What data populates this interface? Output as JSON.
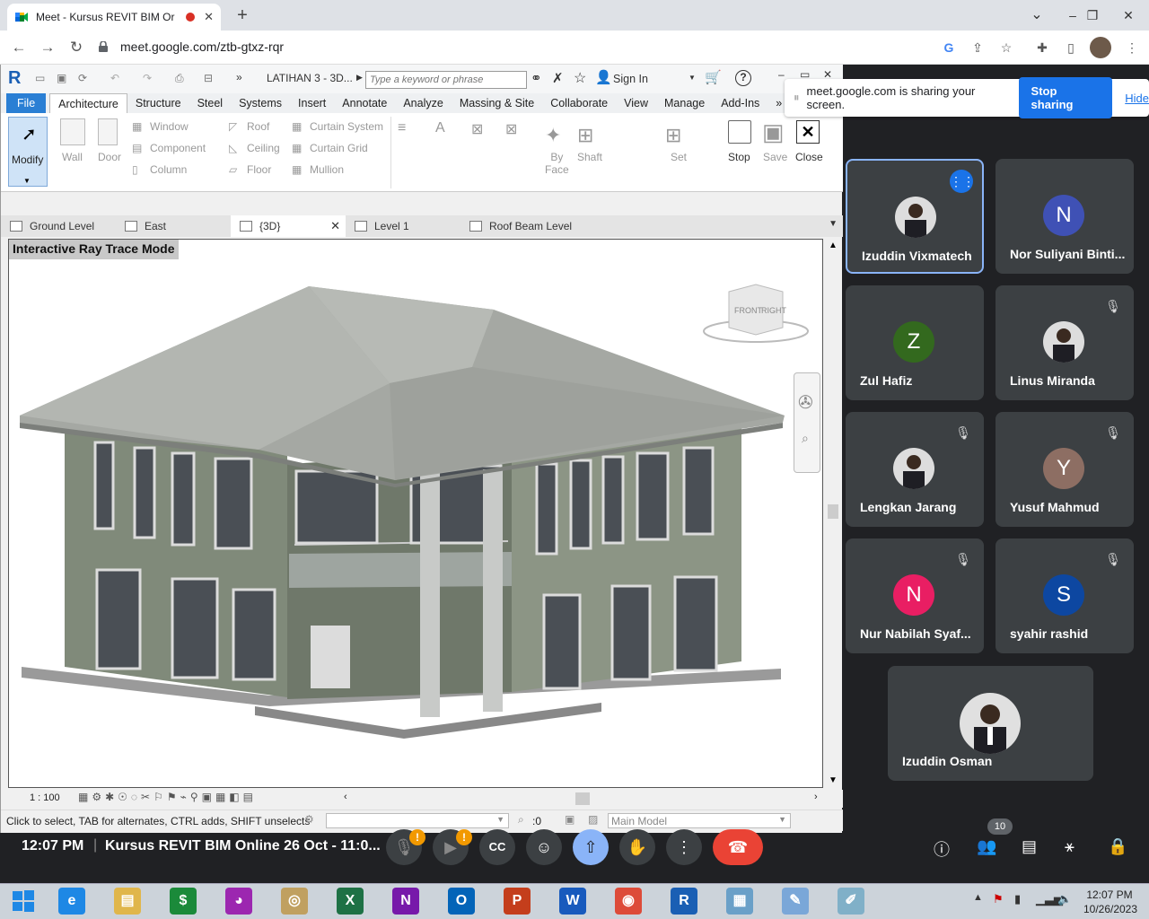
{
  "browser": {
    "tab_title": "Meet - Kursus REVIT BIM Or",
    "url": "meet.google.com/ztb-gtxz-rqr",
    "new_tab": "+",
    "min": "–",
    "max": "❐",
    "close": "✕",
    "collapse": "⌄"
  },
  "revit": {
    "doc_title": "LATIHAN 3 - 3D...",
    "search_placeholder": "Type a keyword or phrase",
    "sign_in": "Sign In",
    "ribbon_tabs": [
      "File",
      "Architecture",
      "Structure",
      "Steel",
      "Systems",
      "Insert",
      "Annotate",
      "Analyze",
      "Massing & Site",
      "Collaborate",
      "View",
      "Manage",
      "Add-Ins"
    ],
    "build": {
      "modify": "Modify",
      "wall": "Wall",
      "door": "Door",
      "window": "Window",
      "component": "Component",
      "column": "Column",
      "roof": "Roof",
      "ceiling": "Ceiling",
      "floor": "Floor",
      "curtain_system": "Curtain System",
      "curtain_grid": "Curtain Grid",
      "mullion": "Mullion",
      "by_face": "By\nFace",
      "shaft": "Shaft",
      "set": "Set",
      "stop": "Stop",
      "save": "Save",
      "close": "Close"
    },
    "view_tabs": [
      {
        "label": "Ground Level"
      },
      {
        "label": "East"
      },
      {
        "label": "{3D}",
        "active": true
      },
      {
        "label": "Level 1"
      },
      {
        "label": "Roof Beam Level"
      }
    ],
    "render_mode": "Interactive Ray Trace Mode",
    "viewcube_front": "FRONT",
    "viewcube_right": "RIGHT",
    "scale": "1 : 100",
    "status_text": "Click to select, TAB for alternates, CTRL adds, SHIFT unselects",
    "selection_count": ":0",
    "model": "Main Model"
  },
  "sharing": {
    "message": "meet.google.com is sharing your screen.",
    "stop": "Stop sharing",
    "hide": "Hide"
  },
  "participants": [
    {
      "name": "Izuddin Vixmatech",
      "initial": "",
      "color": "#5f6368",
      "photo": true,
      "speaking": true
    },
    {
      "name": "Nor Suliyani Binti...",
      "initial": "N",
      "color": "#3f51b5"
    },
    {
      "name": "Zul Hafiz",
      "initial": "Z",
      "color": "#33691e"
    },
    {
      "name": "Linus Miranda",
      "initial": "",
      "color": "#8d6e63",
      "photo": true,
      "muted": true
    },
    {
      "name": "Lengkan Jarang",
      "initial": "",
      "color": "#5d8aa8",
      "photo": true,
      "muted": true
    },
    {
      "name": "Yusuf Mahmud",
      "initial": "Y",
      "color": "#8d6e63",
      "muted": true
    },
    {
      "name": "Nur Nabilah Syaf...",
      "initial": "N",
      "color": "#e91e63",
      "muted": true
    },
    {
      "name": "syahir rashid",
      "initial": "S",
      "color": "#0d47a1",
      "muted": true
    }
  ],
  "self": {
    "name": "Izuddin Osman"
  },
  "meeting": {
    "time": "12:07 PM",
    "separator": "|",
    "title": "Kursus REVIT BIM Online 26 Oct - 11:0...",
    "people_count": "10",
    "alert": "!"
  },
  "taskbar": {
    "time": "12:07 PM",
    "date": "10/26/2023",
    "apps": [
      {
        "label": "e",
        "color": "#1e88e5"
      },
      {
        "label": "▤",
        "color": "#e0b64b"
      },
      {
        "label": "$",
        "color": "#1b8a3a"
      },
      {
        "label": "◕",
        "color": "#9c27b0"
      },
      {
        "label": "◎",
        "color": "#c0a060"
      },
      {
        "label": "X",
        "color": "#1e7145"
      },
      {
        "label": "N",
        "color": "#7719aa"
      },
      {
        "label": "O",
        "color": "#0364b8"
      },
      {
        "label": "P",
        "color": "#c43e1c"
      },
      {
        "label": "W",
        "color": "#185abd"
      },
      {
        "label": "◉",
        "color": "#dd4b39"
      },
      {
        "label": "R",
        "color": "#1a5fb4"
      },
      {
        "label": "▦",
        "color": "#6aa0c8"
      },
      {
        "label": "✎",
        "color": "#7aa7d8"
      },
      {
        "label": "✐",
        "color": "#80b0c8"
      }
    ]
  }
}
